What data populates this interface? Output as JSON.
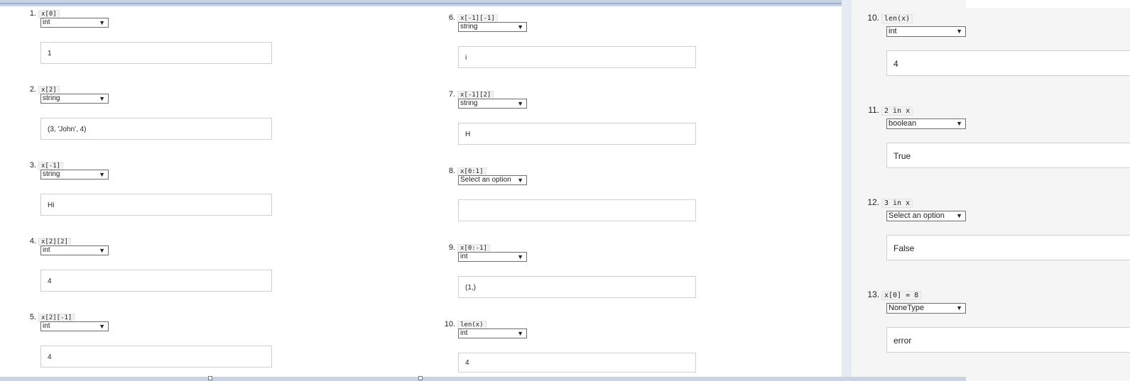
{
  "questions": [
    {
      "num": "1.",
      "expr": "x[0]",
      "type": "int",
      "answer": "1"
    },
    {
      "num": "2.",
      "expr": "x[2]",
      "type": "string",
      "answer": "(3, 'John', 4)"
    },
    {
      "num": "3.",
      "expr": "x[-1]",
      "type": "string",
      "answer": "Hi"
    },
    {
      "num": "4.",
      "expr": "x[2][2]",
      "type": "int",
      "answer": "4"
    },
    {
      "num": "5.",
      "expr": "x[2][-1]",
      "type": "int",
      "answer": "4"
    },
    {
      "num": "6.",
      "expr": "x[-1][-1]",
      "type": "string",
      "answer": "i"
    },
    {
      "num": "7.",
      "expr": "x[-1][2]",
      "type": "string",
      "answer": "H"
    },
    {
      "num": "8.",
      "expr": "x[0:1]",
      "type": "Select an option",
      "answer": ""
    },
    {
      "num": "9.",
      "expr": "x[0:-1]",
      "type": "int",
      "answer": "(1,)"
    },
    {
      "num": "10.",
      "expr": "len(x)",
      "type": "int",
      "answer": "4"
    }
  ],
  "right_panel": [
    {
      "num": "10.",
      "expr": "len(x)",
      "type": "int",
      "answer": "4"
    },
    {
      "num": "11.",
      "expr": "2 in x",
      "type": "boolean",
      "answer": "True"
    },
    {
      "num": "12.",
      "expr": "3 in x",
      "type": "Select an option",
      "answer": "False"
    },
    {
      "num": "13.",
      "expr": "x[0] = 8",
      "type": "NoneType",
      "answer": "error"
    }
  ],
  "icons": {
    "dropdown": "dropdown-arrow-icon"
  },
  "colors": {
    "frame": "#c8d4e6",
    "side_panel": "#f5f5f5",
    "input_border": "#cfcfcf"
  }
}
